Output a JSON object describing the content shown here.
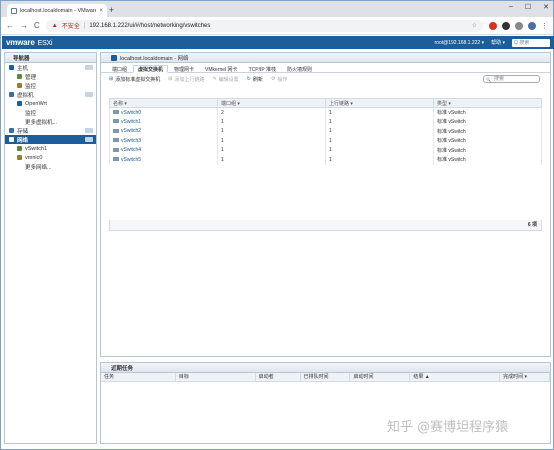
{
  "browser": {
    "tab_title": "localhost.localdomain - VMware",
    "tab_close": "×",
    "new_tab": "+",
    "window_controls": [
      "–",
      "☐",
      "✕"
    ],
    "nav": [
      "←",
      "→",
      "C"
    ],
    "security": "不安全",
    "url": "192.168.1.222/ui/#/host/networking/vswitches"
  },
  "esxi": {
    "logo": "vmware",
    "product": "ESXi",
    "user": "root@192.168.1.222 ▾",
    "help": "帮助 ▾",
    "search_placeholder": "Q 搜索"
  },
  "navigator": {
    "title": "导航器",
    "items": [
      {
        "label": "主机",
        "level": 0
      },
      {
        "label": "管理",
        "level": 1
      },
      {
        "label": "监控",
        "level": 1
      },
      {
        "label": "虚拟机",
        "level": 0
      },
      {
        "label": "OpenWrt",
        "level": 1
      },
      {
        "label": "监控",
        "level": 2
      },
      {
        "label": "更多虚拟机...",
        "level": 2
      },
      {
        "label": "存储",
        "level": 0
      },
      {
        "label": "网络",
        "level": 0,
        "selected": true
      },
      {
        "label": "vSwitch1",
        "level": 1
      },
      {
        "label": "vmnic0",
        "level": 1
      },
      {
        "label": "更多网络...",
        "level": 2
      }
    ]
  },
  "main": {
    "title": "localhost.localdomain - 网络",
    "tabs": [
      "端口组",
      "虚拟交换机",
      "物理网卡",
      "VMkernel 网卡",
      "TCP/IP 堆栈",
      "防火墙规则"
    ],
    "active_tab": 1,
    "toolbar": {
      "add": "添加标准虚拟交换机",
      "add_uplink": "添加上行链路",
      "edit": "编辑设置",
      "refresh": "刷新",
      "actions": "操作",
      "search_placeholder": "搜索"
    },
    "columns": [
      "名称 ▾",
      "端口组 ▾",
      "上行链路 ▾",
      "类型 ▾"
    ],
    "rows": [
      {
        "name": "vSwitch0",
        "portgroups": "2",
        "uplinks": "1",
        "type": "标准 vSwitch"
      },
      {
        "name": "vSwitch1",
        "portgroups": "1",
        "uplinks": "1",
        "type": "标准 vSwitch"
      },
      {
        "name": "vSwitch2",
        "portgroups": "1",
        "uplinks": "1",
        "type": "标准 vSwitch"
      },
      {
        "name": "vSwitch3",
        "portgroups": "1",
        "uplinks": "1",
        "type": "标准 vSwitch"
      },
      {
        "name": "vSwitch4",
        "portgroups": "1",
        "uplinks": "1",
        "type": "标准 vSwitch"
      },
      {
        "name": "vSwitch5",
        "portgroups": "1",
        "uplinks": "1",
        "type": "标准 vSwitch"
      }
    ],
    "count": "6 项"
  },
  "tasks": {
    "title": "近期任务",
    "columns": [
      "任务",
      "目标",
      "启动者",
      "已排队时间",
      "启动时间",
      "结果 ▲",
      "完成时间 ▾"
    ]
  },
  "watermark": "知乎 @赛博坦程序猿"
}
